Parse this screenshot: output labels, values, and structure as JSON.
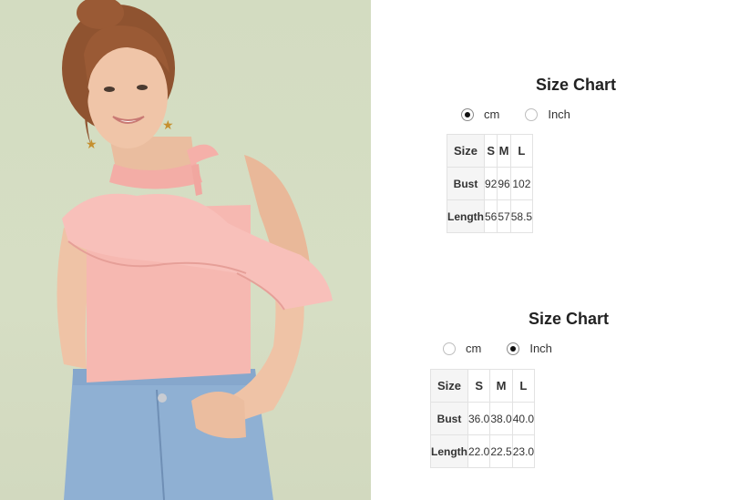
{
  "charts": [
    {
      "title": "Size Chart",
      "units": [
        {
          "label": "cm",
          "selected": true
        },
        {
          "label": "Inch",
          "selected": false
        }
      ],
      "header": [
        "Size",
        "S",
        "M",
        "L"
      ],
      "rows": [
        {
          "label": "Bust",
          "values": [
            "92",
            "96",
            "102"
          ]
        },
        {
          "label": "Length",
          "values": [
            "56",
            "57",
            "58.5"
          ]
        }
      ]
    },
    {
      "title": "Size Chart",
      "units": [
        {
          "label": "cm",
          "selected": false
        },
        {
          "label": "Inch",
          "selected": true
        }
      ],
      "header": [
        "Size",
        "S",
        "M",
        "L"
      ],
      "rows": [
        {
          "label": "Bust",
          "values": [
            "36.0",
            "38.0",
            "40.0"
          ]
        },
        {
          "label": "Length",
          "values": [
            "22.0",
            "22.5",
            "23.0"
          ]
        }
      ]
    }
  ],
  "colors": {
    "background_photo": "#d4dcc2",
    "top": "#f4b3ad",
    "jeans": "#8fb0d3",
    "hair": "#9a5a35",
    "skin": "#efc3a6",
    "table_border": "#e2e2e2",
    "table_header_bg": "#f5f5f5"
  }
}
